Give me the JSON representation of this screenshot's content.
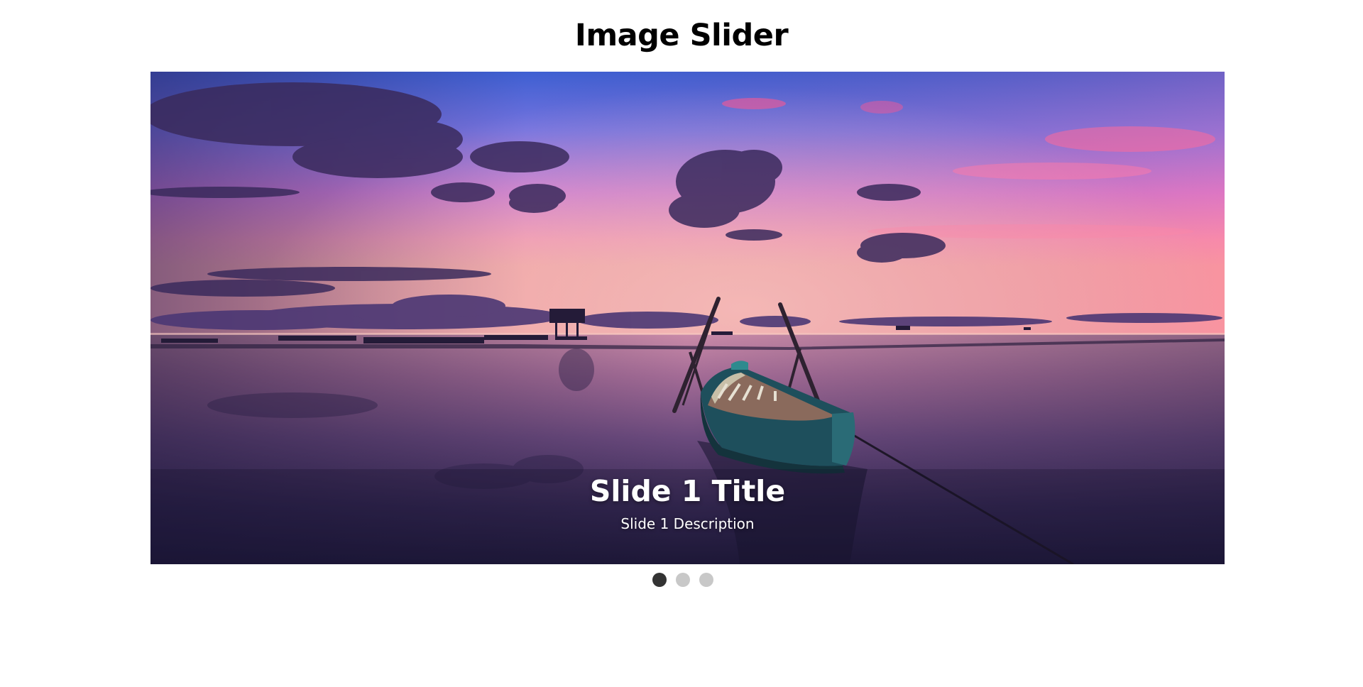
{
  "header": {
    "title": "Image Slider"
  },
  "slider": {
    "active_index": 0,
    "slides": [
      {
        "title": "Slide 1 Title",
        "description": "Slide 1 Description",
        "image": "sunset-lake-boat"
      }
    ],
    "dot_count": 3
  },
  "colors": {
    "dot_active": "#333333",
    "dot_inactive": "#c8c8c8",
    "caption_text": "#ffffff",
    "title_text": "#000000"
  }
}
